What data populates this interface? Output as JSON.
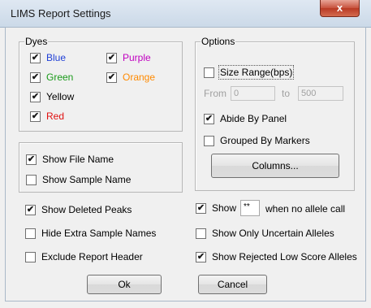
{
  "window": {
    "title": "LIMS Report Settings",
    "close_glyph": "x"
  },
  "check_glyph": "✔",
  "dyes": {
    "legend": "Dyes",
    "items": [
      {
        "label": "Blue",
        "checked": true,
        "color": "#1f3fd6"
      },
      {
        "label": "Purple",
        "checked": true,
        "color": "#c000c0"
      },
      {
        "label": "Green",
        "checked": true,
        "color": "#1a9a1a"
      },
      {
        "label": "Orange",
        "checked": true,
        "color": "#ff8a00"
      },
      {
        "label": "Yellow",
        "checked": true,
        "color": "#000000"
      },
      {
        "label": "Red",
        "checked": true,
        "color": "#e01010"
      }
    ]
  },
  "file_group": {
    "show_file_name": {
      "label": "Show File Name",
      "checked": true
    },
    "show_sample_name": {
      "label": "Show Sample Name",
      "checked": false
    }
  },
  "options": {
    "legend": "Options",
    "size_range": {
      "label": "Size Range(bps)",
      "checked": false
    },
    "from_label": "From",
    "from_value": "0",
    "to_label": "to",
    "to_value": "500",
    "abide_by_panel": {
      "label": "Abide By Panel",
      "checked": true
    },
    "grouped_by_markers": {
      "label": "Grouped By Markers",
      "checked": false
    },
    "columns_button": "Columns..."
  },
  "left_checks": [
    {
      "label": "Show Deleted Peaks",
      "checked": true
    },
    {
      "label": "Hide Extra Sample Names",
      "checked": false
    },
    {
      "label": "Exclude Report Header",
      "checked": false
    }
  ],
  "right_checks": {
    "show_prefix": "Show",
    "show_value": "**",
    "show_suffix": "when no allele call",
    "show_checked": true,
    "uncertain": {
      "label": "Show Only Uncertain Alleles",
      "checked": false
    },
    "rejected": {
      "label": "Show Rejected Low Score Alleles",
      "checked": true
    }
  },
  "buttons": {
    "ok": "Ok",
    "cancel": "Cancel"
  }
}
